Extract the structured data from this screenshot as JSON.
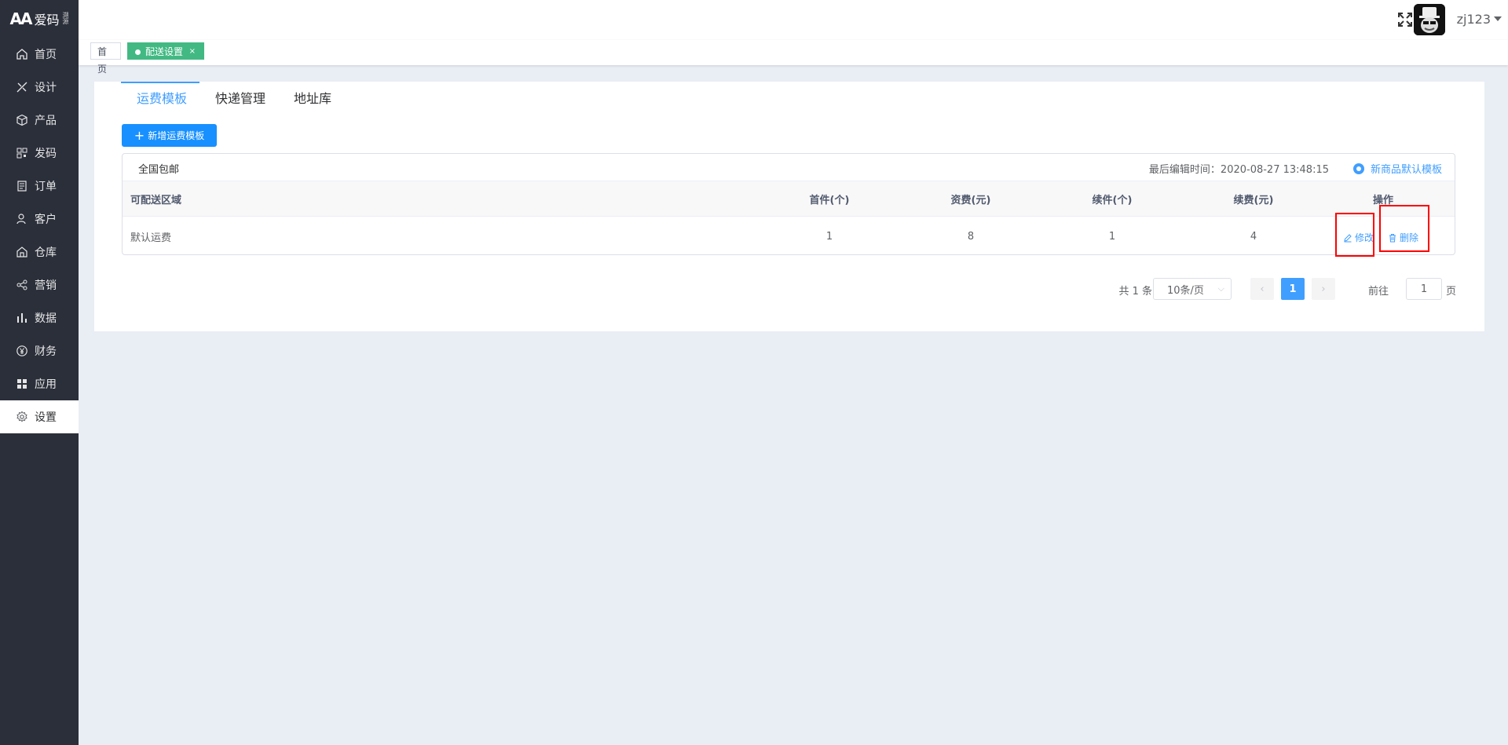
{
  "brand": {
    "logo_mark": "AA",
    "name": "爱码",
    "small": "溯源"
  },
  "sidebar": {
    "items": [
      {
        "label": "首页",
        "icon": "home-icon"
      },
      {
        "label": "设计",
        "icon": "design-icon"
      },
      {
        "label": "产品",
        "icon": "box-icon"
      },
      {
        "label": "发码",
        "icon": "qrcode-icon"
      },
      {
        "label": "订单",
        "icon": "order-icon"
      },
      {
        "label": "客户",
        "icon": "customer-icon"
      },
      {
        "label": "仓库",
        "icon": "warehouse-icon"
      },
      {
        "label": "营销",
        "icon": "share-icon"
      },
      {
        "label": "数据",
        "icon": "bar-chart-icon"
      },
      {
        "label": "财务",
        "icon": "yen-icon"
      },
      {
        "label": "应用",
        "icon": "apps-icon"
      },
      {
        "label": "设置",
        "icon": "gear-icon"
      }
    ],
    "active_index": 11
  },
  "header": {
    "username": "zj123"
  },
  "tags": {
    "home": "首页",
    "current": "配送设置",
    "close": "×"
  },
  "tabs": [
    "运费模板",
    "快递管理",
    "地址库"
  ],
  "add_button": "新增运费模板",
  "template": {
    "name": "全国包邮",
    "last_edit": "最后编辑时间：2020-08-27 13:48:15",
    "default_label": "新商品默认模板",
    "columns": [
      "可配送区域",
      "首件(个)",
      "资费(元)",
      "续件(个)",
      "续费(元)",
      "操作"
    ],
    "rows": [
      {
        "area": "默认运费",
        "first": "1",
        "fee": "8",
        "more": "1",
        "more_fee": "4"
      }
    ],
    "edit_label": "修改",
    "delete_label": "删除"
  },
  "pagination": {
    "total": "共 1 条",
    "page_size": "10条/页",
    "current_page": "1",
    "goto_label": "前往",
    "goto_value": "1",
    "page_suffix": "页"
  },
  "colors": {
    "primary": "#409eff",
    "sidebar": "#2b2f3a",
    "tag_active": "#42b983",
    "highlight": "#ff0000"
  }
}
